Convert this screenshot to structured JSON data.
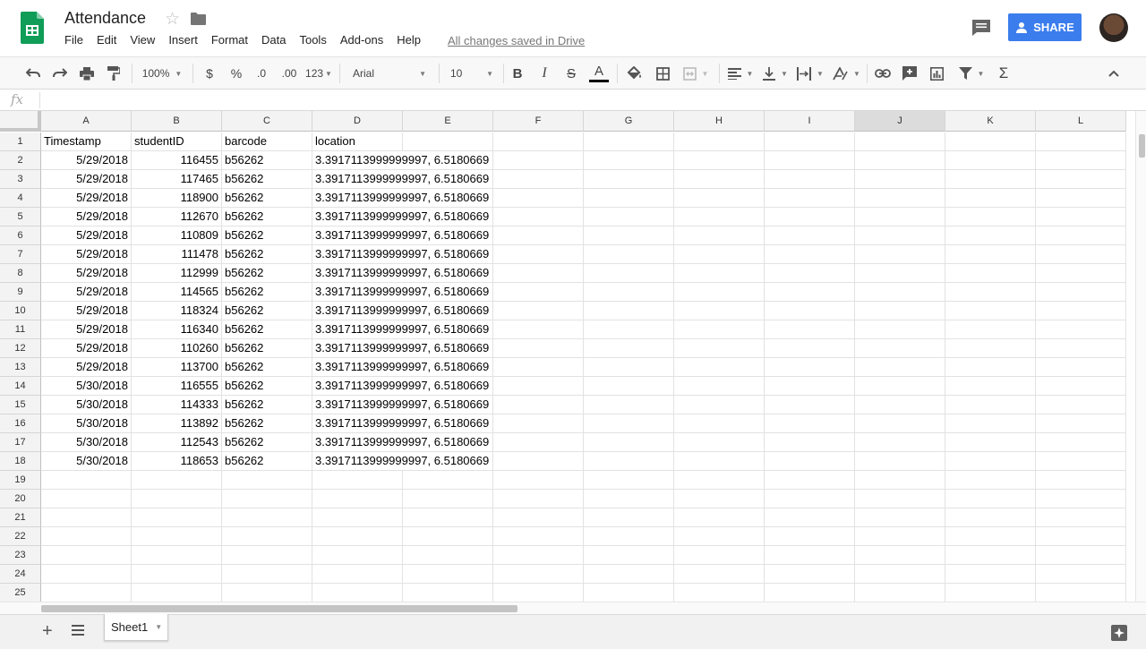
{
  "app": {
    "title": "Attendance",
    "saved_status": "All changes saved in Drive",
    "share_label": "SHARE"
  },
  "menu": [
    "File",
    "Edit",
    "View",
    "Insert",
    "Format",
    "Data",
    "Tools",
    "Add-ons",
    "Help"
  ],
  "toolbar": {
    "zoom": "100%",
    "currency": "$",
    "percent": "%",
    "dec_decrease": ".0",
    "dec_increase": ".00",
    "more_formats": "123",
    "font": "Arial",
    "font_size": "10",
    "bold": "B",
    "italic": "I",
    "strike": "S",
    "text_color": "A",
    "functions": "Σ"
  },
  "formula_bar": {
    "fx": "fx",
    "value": ""
  },
  "columns": [
    "A",
    "B",
    "C",
    "D",
    "E",
    "F",
    "G",
    "H",
    "I",
    "J",
    "K",
    "L"
  ],
  "selected_column": "J",
  "row_numbers": [
    "1",
    "2",
    "3",
    "4",
    "5",
    "6",
    "7",
    "8",
    "9",
    "10",
    "11",
    "12",
    "13",
    "14",
    "15",
    "16",
    "17",
    "18",
    "19",
    "20",
    "21",
    "22",
    "23",
    "24",
    "25"
  ],
  "sheet": {
    "headers": [
      "Timestamp",
      "studentID",
      "barcode",
      "location"
    ],
    "rows": [
      [
        "5/29/2018",
        "116455",
        "b56262",
        "3.3917113999999997, 6.5180669"
      ],
      [
        "5/29/2018",
        "117465",
        "b56262",
        "3.3917113999999997, 6.5180669"
      ],
      [
        "5/29/2018",
        "118900",
        "b56262",
        "3.3917113999999997, 6.5180669"
      ],
      [
        "5/29/2018",
        "112670",
        "b56262",
        "3.3917113999999997, 6.5180669"
      ],
      [
        "5/29/2018",
        "110809",
        "b56262",
        "3.3917113999999997, 6.5180669"
      ],
      [
        "5/29/2018",
        "111478",
        "b56262",
        "3.3917113999999997, 6.5180669"
      ],
      [
        "5/29/2018",
        "112999",
        "b56262",
        "3.3917113999999997, 6.5180669"
      ],
      [
        "5/29/2018",
        "114565",
        "b56262",
        "3.3917113999999997, 6.5180669"
      ],
      [
        "5/29/2018",
        "118324",
        "b56262",
        "3.3917113999999997, 6.5180669"
      ],
      [
        "5/29/2018",
        "116340",
        "b56262",
        "3.3917113999999997, 6.5180669"
      ],
      [
        "5/29/2018",
        "110260",
        "b56262",
        "3.3917113999999997, 6.5180669"
      ],
      [
        "5/29/2018",
        "113700",
        "b56262",
        "3.3917113999999997, 6.5180669"
      ],
      [
        "5/30/2018",
        "116555",
        "b56262",
        "3.3917113999999997, 6.5180669"
      ],
      [
        "5/30/2018",
        "114333",
        "b56262",
        "3.3917113999999997, 6.5180669"
      ],
      [
        "5/30/2018",
        "113892",
        "b56262",
        "3.3917113999999997, 6.5180669"
      ],
      [
        "5/30/2018",
        "112543",
        "b56262",
        "3.3917113999999997, 6.5180669"
      ],
      [
        "5/30/2018",
        "118653",
        "b56262",
        "3.3917113999999997, 6.5180669"
      ]
    ]
  },
  "sheet_tabs": [
    "Sheet1"
  ],
  "colors": {
    "accent": "#3b7ded",
    "sheets_green": "#0f9d58",
    "header_bg": "#f3f3f3",
    "selected_header_bg": "#dcdcdc"
  }
}
